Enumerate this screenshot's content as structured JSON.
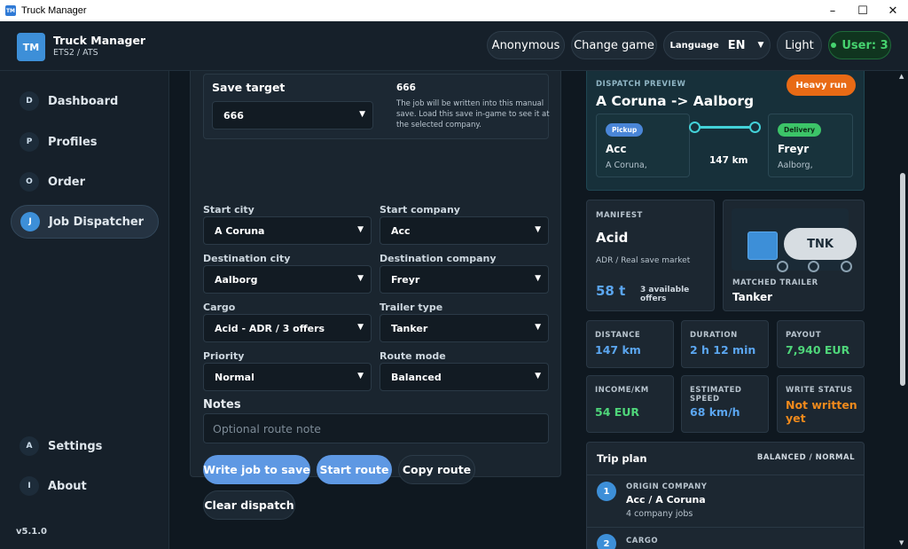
{
  "window": {
    "title": "Truck Manager",
    "icon_text": "TM",
    "minimize": "–",
    "maximize": "☐",
    "close": "✕"
  },
  "header": {
    "logo": "TM",
    "app_name": "Truck Manager",
    "app_sub": "ETS2 / ATS",
    "profile_btn": "Anonymous",
    "change_game_btn": "Change game",
    "language_label": "Language",
    "language_value": "EN",
    "theme_btn": "Light",
    "user_badge": "User: 3"
  },
  "sidebar": {
    "items": [
      {
        "badge": "D",
        "label": "Dashboard"
      },
      {
        "badge": "P",
        "label": "Profiles"
      },
      {
        "badge": "O",
        "label": "Order"
      },
      {
        "badge": "J",
        "label": "Job Dispatcher",
        "active": true
      },
      {
        "badge": "A",
        "label": "Settings"
      },
      {
        "badge": "I",
        "label": "About"
      }
    ],
    "version": "v5.1.0"
  },
  "form": {
    "save_target_label": "Save target",
    "save_target_value": "666",
    "save_number": "666",
    "save_desc": "The job will be written into this manual save. Load this save in-game to see it at the selected company.",
    "start_city_label": "Start city",
    "start_city_value": "A Coruna",
    "start_company_label": "Start company",
    "start_company_value": "Acc",
    "dest_city_label": "Destination city",
    "dest_city_value": "Aalborg",
    "dest_company_label": "Destination company",
    "dest_company_value": "Freyr",
    "cargo_label": "Cargo",
    "cargo_value": "Acid - ADR / 3 offers",
    "trailer_label": "Trailer type",
    "trailer_value": "Tanker",
    "priority_label": "Priority",
    "priority_value": "Normal",
    "route_mode_label": "Route mode",
    "route_mode_value": "Balanced",
    "notes_label": "Notes",
    "notes_placeholder": "Optional route note",
    "write_btn": "Write job to save",
    "start_btn": "Start route",
    "copy_btn": "Copy route",
    "clear_btn": "Clear dispatch"
  },
  "preview": {
    "section": "DISPATCH PREVIEW",
    "route": "A Coruna -> Aalborg",
    "heavy": "Heavy run",
    "pickup_tag": "Pickup",
    "pickup_name": "Acc",
    "pickup_city": "A Coruna,",
    "delivery_tag": "Delivery",
    "delivery_name": "Freyr",
    "delivery_city": "Aalborg,",
    "distance": "147 km"
  },
  "manifest": {
    "label": "MANIFEST",
    "cargo": "Acid",
    "sub": "ADR / Real save market",
    "weight": "58 t",
    "offers": "3 available offers",
    "trailer_label": "MATCHED TRAILER",
    "trailer": "Tanker",
    "tank_text": "TNK"
  },
  "stats": {
    "distance_label": "DISTANCE",
    "distance": "147 km",
    "duration_label": "DURATION",
    "duration": "2 h 12 min",
    "payout_label": "PAYOUT",
    "payout": "7,940 EUR",
    "income_label": "INCOME/KM",
    "income": "54 EUR",
    "speed_label": "ESTIMATED SPEED",
    "speed": "68 km/h",
    "write_label": "WRITE STATUS",
    "write": "Not written yet"
  },
  "trip": {
    "title": "Trip plan",
    "mode": "BALANCED / NORMAL",
    "steps": [
      {
        "num": "1",
        "label": "ORIGIN COMPANY",
        "value": "Acc / A Coruna",
        "sub": "4 company jobs"
      },
      {
        "num": "2",
        "label": "CARGO"
      }
    ]
  },
  "colors": {
    "accent": "#3d8fd8",
    "orange": "#e86a15",
    "green": "#46d36f"
  }
}
